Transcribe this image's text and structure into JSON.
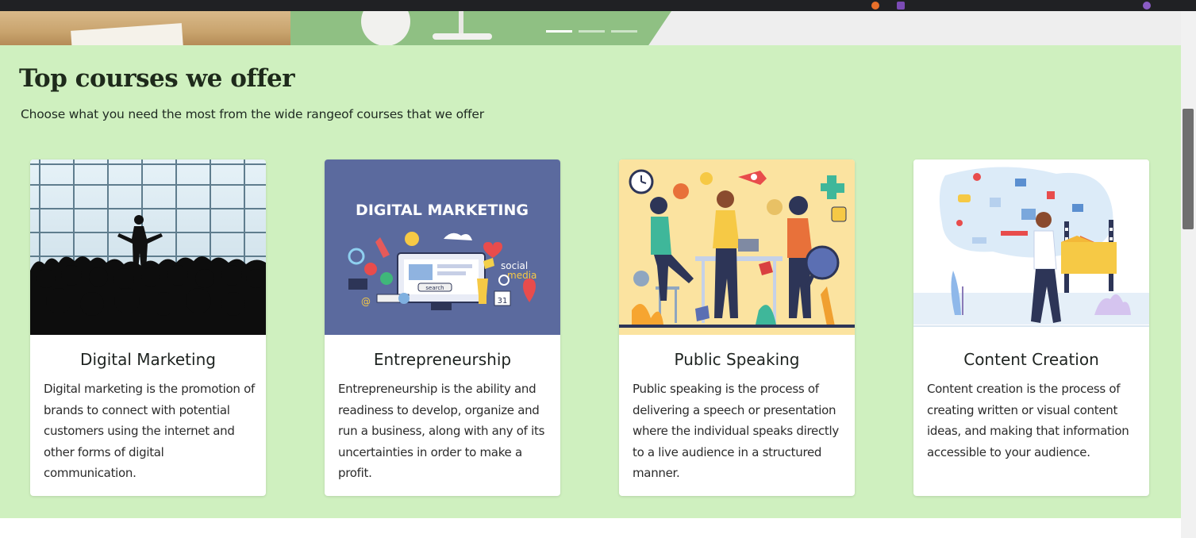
{
  "section": {
    "title": "Top courses we offer",
    "subtitle": "Choose what you need the most from the wide rangeof courses that we offer"
  },
  "colors": {
    "section_bg": "#cff0bf",
    "card_bg": "#ffffff",
    "title_text": "#1e2a1b"
  },
  "carousel": {
    "slide_count": 3,
    "active_index": 0
  },
  "courses": [
    {
      "title": "Digital Marketing",
      "description": "Digital marketing is the promotion of brands to connect with potential customers using the internet and other forms of digital communication.",
      "image_icon": "speaker-audience-silhouette-image"
    },
    {
      "title": "Entrepreneurship",
      "description": "Entrepreneurship is the ability and readiness to develop, organize and run a business, along with any of its uncertainties in order to make a profit.",
      "image_icon": "digital-marketing-illustration-image",
      "image_text": "DIGITAL MARKETING",
      "image_social": "social",
      "image_media": "media",
      "image_search": "search",
      "image_calendar": "31"
    },
    {
      "title": "Public Speaking",
      "description": "Public speaking is the process of delivering a speech or presentation where the individual speaks directly to a live audience in a structured manner.",
      "image_icon": "team-brainstorm-illustration-image"
    },
    {
      "title": "Content Creation",
      "description": "Content creation is the process of creating written or visual content ideas, and making that information accessible to your audience.",
      "image_icon": "content-creator-illustration-image"
    }
  ]
}
